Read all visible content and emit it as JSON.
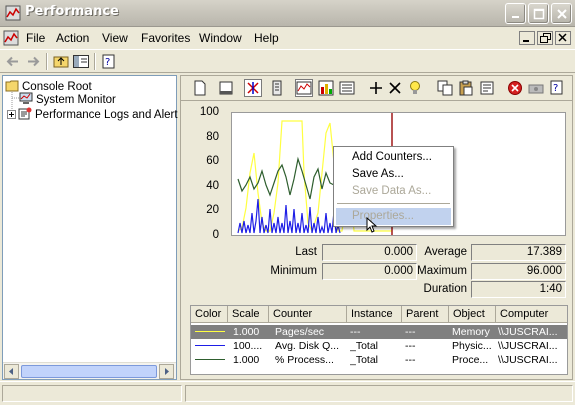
{
  "window": {
    "title": "Performance"
  },
  "menubar": {
    "items": [
      "File",
      "Action",
      "View",
      "Favorites",
      "Window",
      "Help"
    ]
  },
  "tree": {
    "items": [
      {
        "label": "Console Root",
        "icon": "folder-icon"
      },
      {
        "label": "System Monitor",
        "icon": "monitor-icon"
      },
      {
        "label": "Performance Logs and Alert",
        "icon": "logs-icon"
      }
    ]
  },
  "graph": {
    "y_ticks": [
      "100",
      "80",
      "60",
      "40",
      "20",
      "0"
    ],
    "colors": {
      "pages": "#ffff40",
      "disk": "#1e1ee6",
      "processor": "#2e5e2e",
      "bar": "#a01818"
    }
  },
  "stats": {
    "last_label": "Last",
    "last_value": "0.000",
    "average_label": "Average",
    "average_value": "17.389",
    "minimum_label": "Minimum",
    "minimum_value": "0.000",
    "maximum_label": "Maximum",
    "maximum_value": "96.000",
    "duration_label": "Duration",
    "duration_value": "1:40"
  },
  "counter_table": {
    "headers": [
      "Color",
      "Scale",
      "Counter",
      "Instance",
      "Parent",
      "Object",
      "Computer"
    ],
    "rows": [
      {
        "color": "#ffff40",
        "scale": "1.000",
        "counter": "Pages/sec",
        "instance": "---",
        "parent": "---",
        "object": "Memory",
        "computer": "\\\\JUSCRAI..."
      },
      {
        "color": "#1e1ee6",
        "scale": "100....",
        "counter": "Avg. Disk Q...",
        "instance": "_Total",
        "parent": "---",
        "object": "Physic...",
        "computer": "\\\\JUSCRAI..."
      },
      {
        "color": "#2e5e2e",
        "scale": "1.000",
        "counter": "% Process...",
        "instance": "_Total",
        "parent": "---",
        "object": "Proce...",
        "computer": "\\\\JUSCRAI..."
      }
    ]
  },
  "context_menu": {
    "items": [
      {
        "label": "Add Counters...",
        "disabled": false
      },
      {
        "label": "Save As...",
        "disabled": false
      },
      {
        "label": "Save Data As...",
        "disabled": true
      },
      {
        "label": "Properties...",
        "disabled": false
      }
    ]
  }
}
